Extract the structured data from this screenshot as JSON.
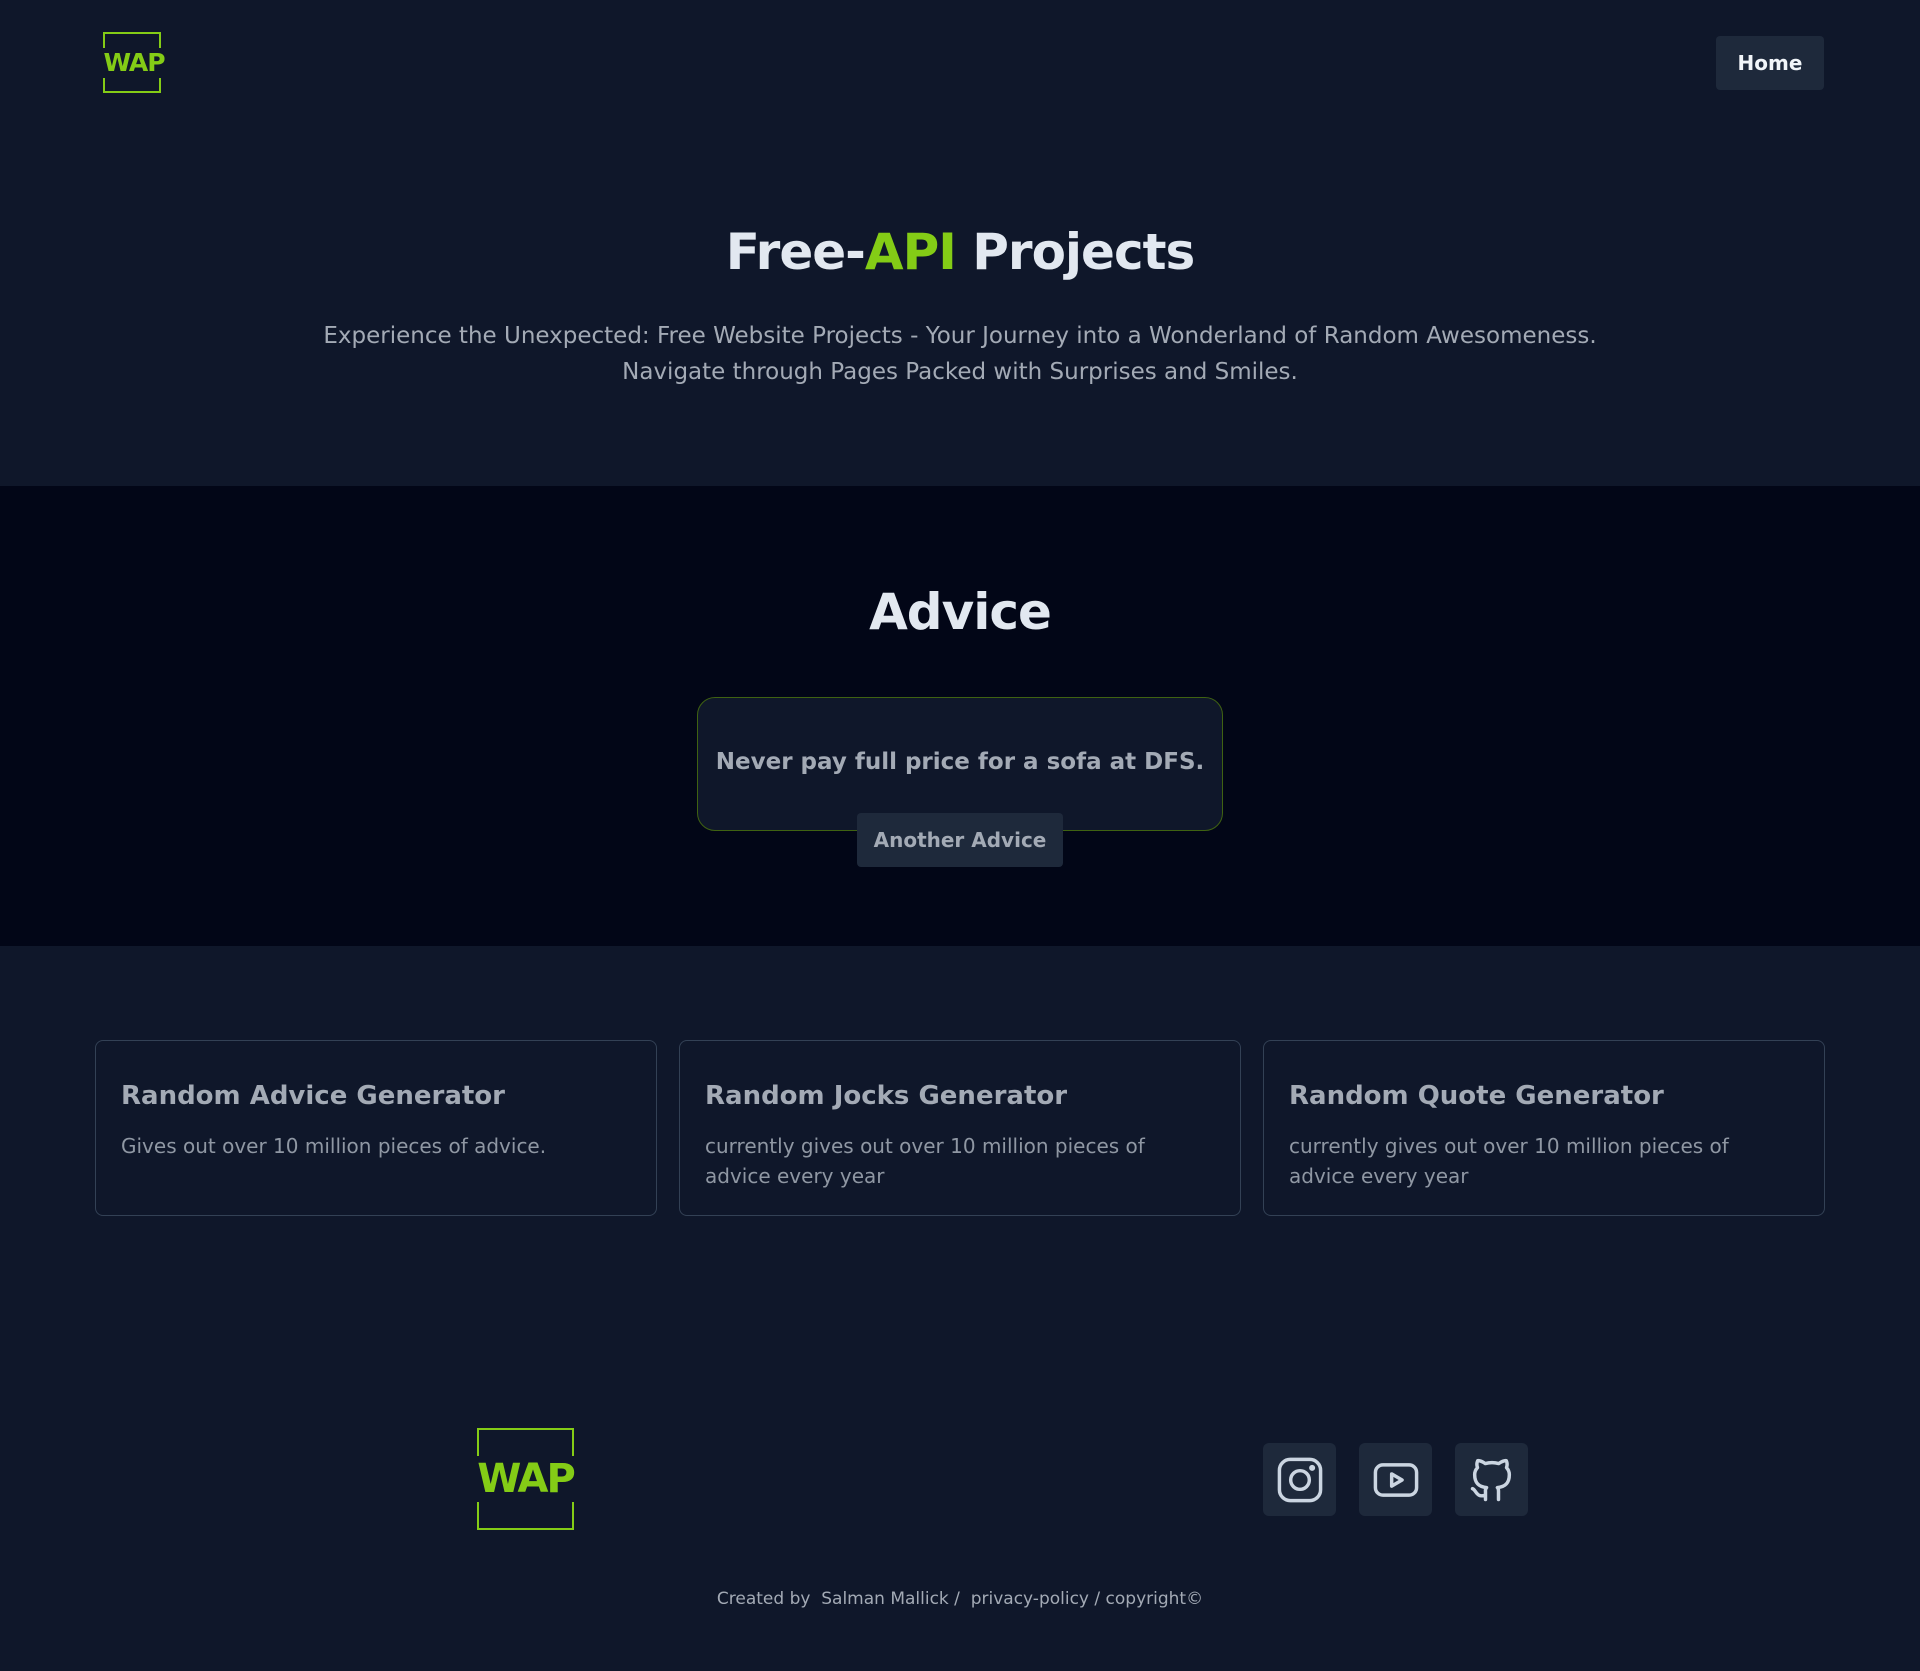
{
  "header": {
    "logo_text": "WAP",
    "nav_home_label": "Home"
  },
  "hero": {
    "title_part1": "Free-",
    "title_accent": "API",
    "title_part2": " Projects",
    "subtitle_line1": "Experience the Unexpected: Free Website Projects - Your Journey into a Wonderland of Random Awesomeness.",
    "subtitle_line2": "Navigate through Pages Packed with Surprises and Smiles."
  },
  "advice": {
    "section_title": "Advice",
    "advice_text": "Never pay full price for a sofa at DFS.",
    "button_label": "Another Advice"
  },
  "projects": [
    {
      "title": "Random Advice Generator",
      "description": "Gives out over 10 million pieces of advice."
    },
    {
      "title": "Random Jocks Generator",
      "description": "currently gives out over 10 million pieces of advice every year"
    },
    {
      "title": "Random Quote Generator",
      "description": "currently gives out over 10 million pieces of advice every year"
    }
  ],
  "footer": {
    "logo_text": "WAP",
    "social_icons": [
      "instagram-icon",
      "youtube-icon",
      "github-icon"
    ],
    "created_by_text": "Created by  Salman Mallick /  privacy-policy / copyright©"
  },
  "colors": {
    "background": "#0f172a",
    "advice_background": "#020617",
    "accent": "#84cc16",
    "button": "#1e293b"
  }
}
